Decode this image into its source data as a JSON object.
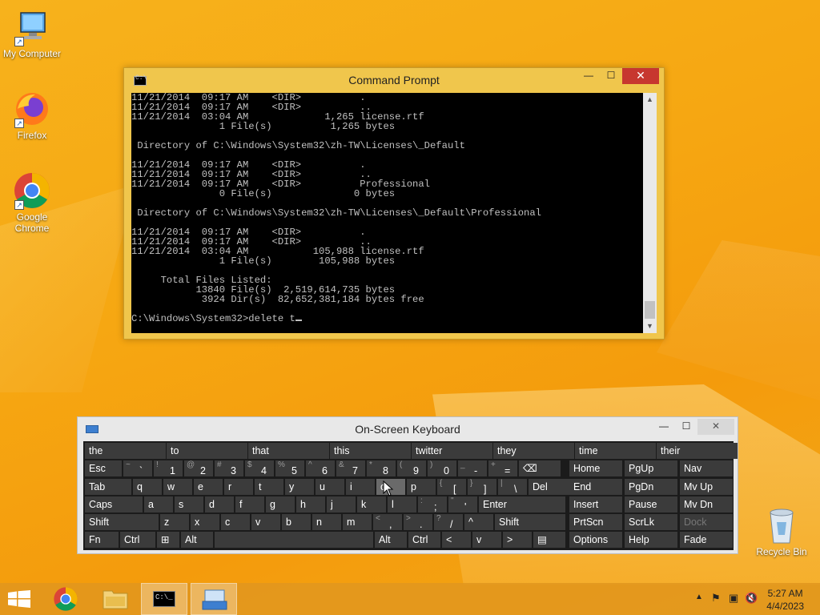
{
  "desktop": {
    "icons": [
      {
        "label": "My Computer"
      },
      {
        "label": "Firefox"
      },
      {
        "label": "Google Chrome"
      },
      {
        "label": "Recycle Bin"
      }
    ]
  },
  "cmd": {
    "title": "Command Prompt",
    "lines": [
      "11/21/2014  09:17 AM    <DIR>          .",
      "11/21/2014  09:17 AM    <DIR>          ..",
      "11/21/2014  03:04 AM             1,265 license.rtf",
      "               1 File(s)          1,265 bytes",
      "",
      " Directory of C:\\Windows\\System32\\zh-TW\\Licenses\\_Default",
      "",
      "11/21/2014  09:17 AM    <DIR>          .",
      "11/21/2014  09:17 AM    <DIR>          ..",
      "11/21/2014  09:17 AM    <DIR>          Professional",
      "               0 File(s)              0 bytes",
      "",
      " Directory of C:\\Windows\\System32\\zh-TW\\Licenses\\_Default\\Professional",
      "",
      "11/21/2014  09:17 AM    <DIR>          .",
      "11/21/2014  09:17 AM    <DIR>          ..",
      "11/21/2014  03:04 AM           105,988 license.rtf",
      "               1 File(s)        105,988 bytes",
      "",
      "     Total Files Listed:",
      "           13840 File(s)  2,519,614,735 bytes",
      "            3924 Dir(s)  82,652,381,184 bytes free",
      ""
    ],
    "prompt": "C:\\Windows\\System32>delete t"
  },
  "osk": {
    "title": "On-Screen Keyboard",
    "predictions": [
      "the",
      "to",
      "that",
      "this",
      "twitter",
      "they",
      "time",
      "their"
    ],
    "row1": [
      {
        "label": "Esc"
      },
      {
        "sup": "~",
        "main": "`"
      },
      {
        "sup": "!",
        "main": "1"
      },
      {
        "sup": "@",
        "main": "2"
      },
      {
        "sup": "#",
        "main": "3"
      },
      {
        "sup": "$",
        "main": "4"
      },
      {
        "sup": "%",
        "main": "5"
      },
      {
        "sup": "^",
        "main": "6"
      },
      {
        "sup": "&",
        "main": "7"
      },
      {
        "sup": "*",
        "main": "8"
      },
      {
        "sup": "(",
        "main": "9"
      },
      {
        "sup": ")",
        "main": "0"
      },
      {
        "sup": "_",
        "main": "-"
      },
      {
        "sup": "+",
        "main": "="
      },
      {
        "label": "⌫"
      }
    ],
    "row2": [
      {
        "label": "Tab"
      },
      {
        "label": "q"
      },
      {
        "label": "w"
      },
      {
        "label": "e"
      },
      {
        "label": "r"
      },
      {
        "label": "t"
      },
      {
        "label": "y"
      },
      {
        "label": "u"
      },
      {
        "label": "i"
      },
      {
        "label": "o"
      },
      {
        "label": "p"
      },
      {
        "sup": "{",
        "main": "["
      },
      {
        "sup": "}",
        "main": "]"
      },
      {
        "sup": "|",
        "main": "\\"
      },
      {
        "label": "Del"
      }
    ],
    "row3": [
      {
        "label": "Caps"
      },
      {
        "label": "a"
      },
      {
        "label": "s"
      },
      {
        "label": "d"
      },
      {
        "label": "f"
      },
      {
        "label": "g"
      },
      {
        "label": "h"
      },
      {
        "label": "j"
      },
      {
        "label": "k"
      },
      {
        "label": "l"
      },
      {
        "sup": ":",
        "main": ";"
      },
      {
        "sup": "\"",
        "main": "'"
      },
      {
        "label": "Enter"
      }
    ],
    "row4": [
      {
        "label": "Shift"
      },
      {
        "label": "z"
      },
      {
        "label": "x"
      },
      {
        "label": "c"
      },
      {
        "label": "v"
      },
      {
        "label": "b"
      },
      {
        "label": "n"
      },
      {
        "label": "m"
      },
      {
        "sup": "<",
        "main": ","
      },
      {
        "sup": ">",
        "main": "."
      },
      {
        "sup": "?",
        "main": "/"
      },
      {
        "label": "^"
      },
      {
        "label": "Shift"
      }
    ],
    "row5": [
      {
        "label": "Fn"
      },
      {
        "label": "Ctrl"
      },
      {
        "label": "⊞"
      },
      {
        "label": "Alt"
      },
      {
        "label": ""
      },
      {
        "label": "Alt"
      },
      {
        "label": "Ctrl"
      },
      {
        "label": "<"
      },
      {
        "label": "v"
      },
      {
        "label": ">"
      },
      {
        "label": "▤"
      }
    ],
    "nav": [
      [
        "Home",
        "PgUp",
        "Nav"
      ],
      [
        "End",
        "PgDn",
        "Mv Up"
      ],
      [
        "Insert",
        "Pause",
        "Mv Dn"
      ],
      [
        "PrtScn",
        "ScrLk",
        "Dock"
      ],
      [
        "Options",
        "Help",
        "Fade"
      ]
    ]
  },
  "taskbar": {
    "time": "5:27 AM",
    "date": "4/4/2023"
  }
}
